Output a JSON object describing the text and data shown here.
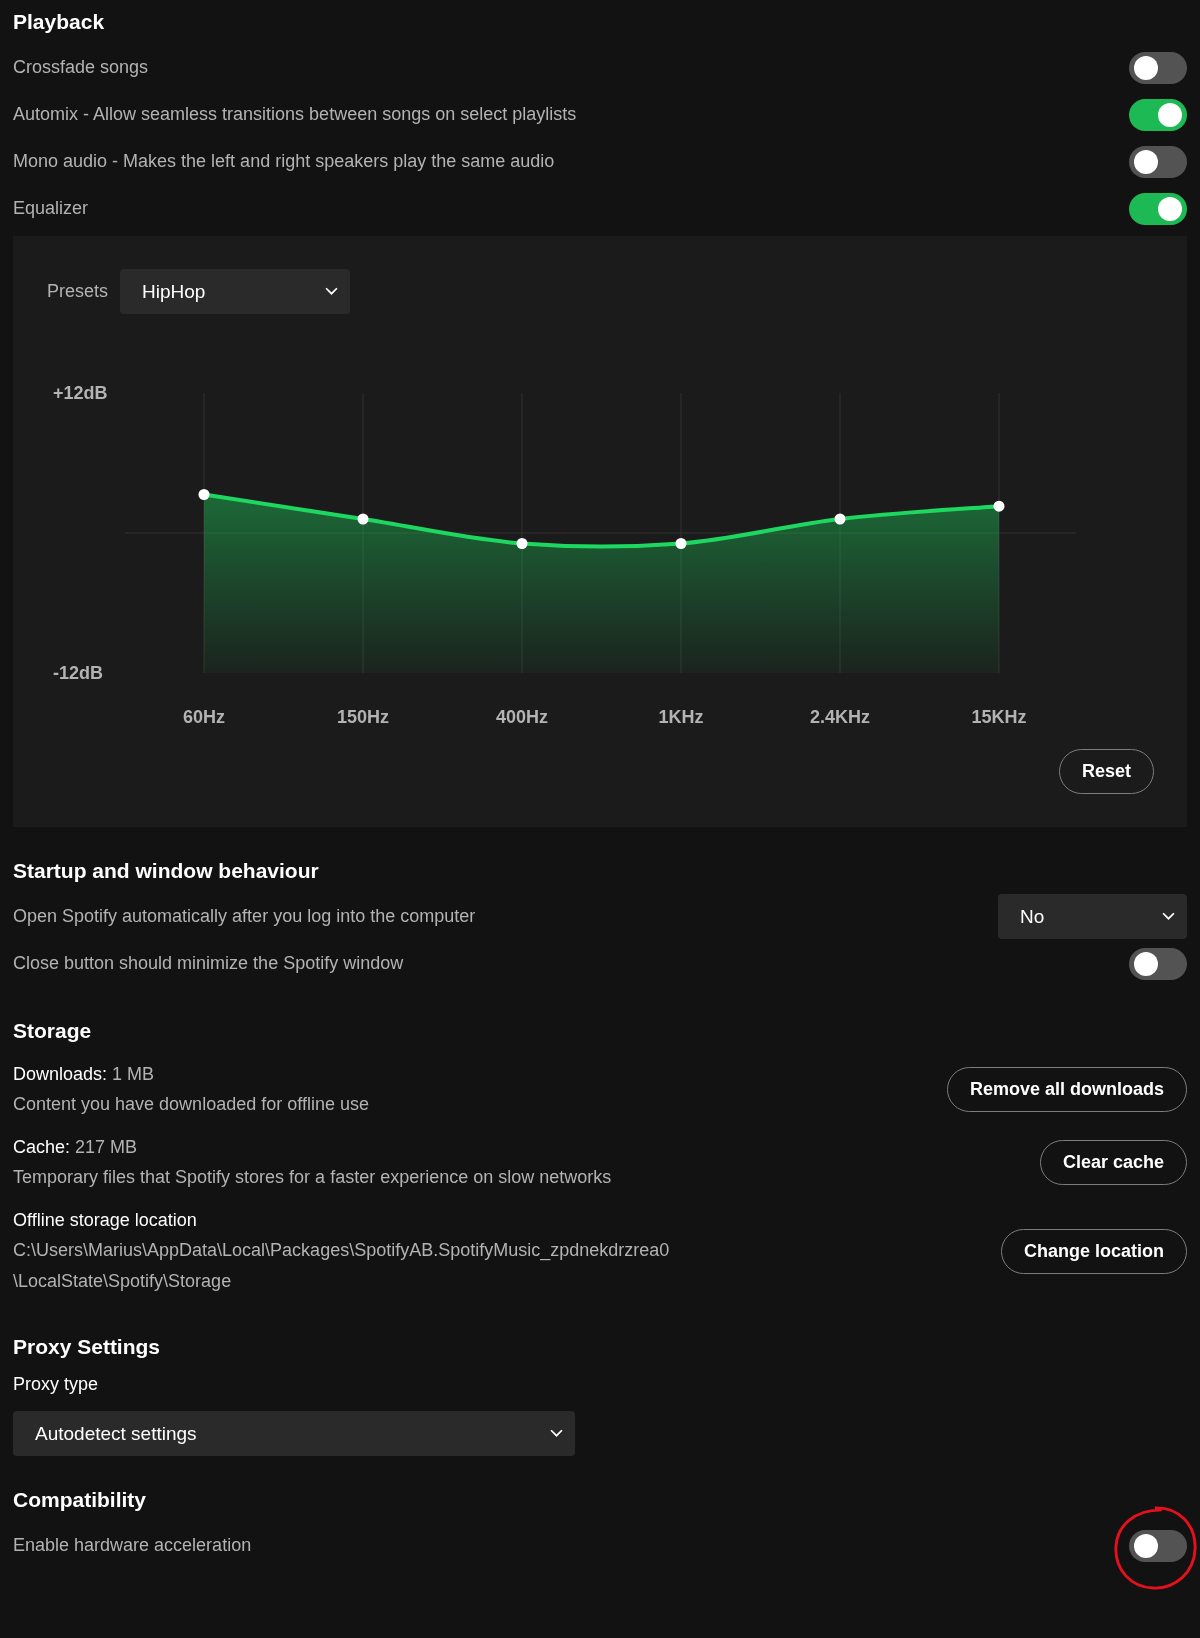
{
  "sections": [
    {
      "title": "Playback",
      "rows": [
        {
          "kind": "toggle",
          "label": "Crossfade songs",
          "on": false
        },
        {
          "kind": "toggle",
          "label": "Automix - Allow seamless transitions between songs on select playlists",
          "on": true
        },
        {
          "kind": "toggle",
          "label": "Mono audio - Makes the left and right speakers play the same audio",
          "on": false
        },
        {
          "kind": "toggle",
          "label": "Equalizer",
          "on": true
        },
        {
          "kind": "equalizer",
          "presets_label": "Presets",
          "preset": "HipHop",
          "reset": "Reset",
          "chart_data": {
            "type": "line",
            "marker": "circle",
            "grid": true,
            "categories": [
              "60Hz",
              "150Hz",
              "400Hz",
              "1KHz",
              "2.4KHz",
              "15KHz"
            ],
            "values": [
              3.3,
              1.2,
              -0.9,
              -0.9,
              1.2,
              2.3
            ],
            "ylim": [
              -12,
              12
            ],
            "yticks": [
              {
                "value": 12,
                "label": "+12dB"
              },
              {
                "value": -12,
                "label": "-12dB"
              }
            ]
          }
        }
      ]
    },
    {
      "title": "Startup and window behaviour",
      "rows": [
        {
          "kind": "select",
          "label": "Open Spotify automatically after you log into the computer",
          "value": "No"
        },
        {
          "kind": "toggle",
          "label": "Close button should minimize the Spotify window",
          "on": false
        }
      ]
    },
    {
      "title": "Storage",
      "rows": [
        {
          "kind": "storage",
          "label": "Downloads:",
          "value": "1 MB",
          "description_lines": [
            "Content you have downloaded for offline use"
          ],
          "button": "Remove all downloads"
        },
        {
          "kind": "storage",
          "label": "Cache:",
          "value": "217 MB",
          "description_lines": [
            "Temporary files that Spotify stores for a faster experience on slow networks"
          ],
          "button": "Clear cache"
        },
        {
          "kind": "storage",
          "label": "Offline storage location",
          "description_lines": [
            "C:\\Users\\Marius\\AppData\\Local\\Packages\\SpotifyAB.SpotifyMusic_zpdnekdrzrea0",
            "\\LocalState\\Spotify\\Storage"
          ],
          "button": "Change location"
        }
      ]
    },
    {
      "title": "Proxy Settings",
      "rows": [
        {
          "kind": "wide_select",
          "label": "Proxy type",
          "value": "Autodetect settings"
        }
      ]
    },
    {
      "title": "Compatibility",
      "rows": [
        {
          "kind": "toggle",
          "label": "Enable hardware acceleration",
          "on": false,
          "highlighted": true
        }
      ]
    }
  ]
}
